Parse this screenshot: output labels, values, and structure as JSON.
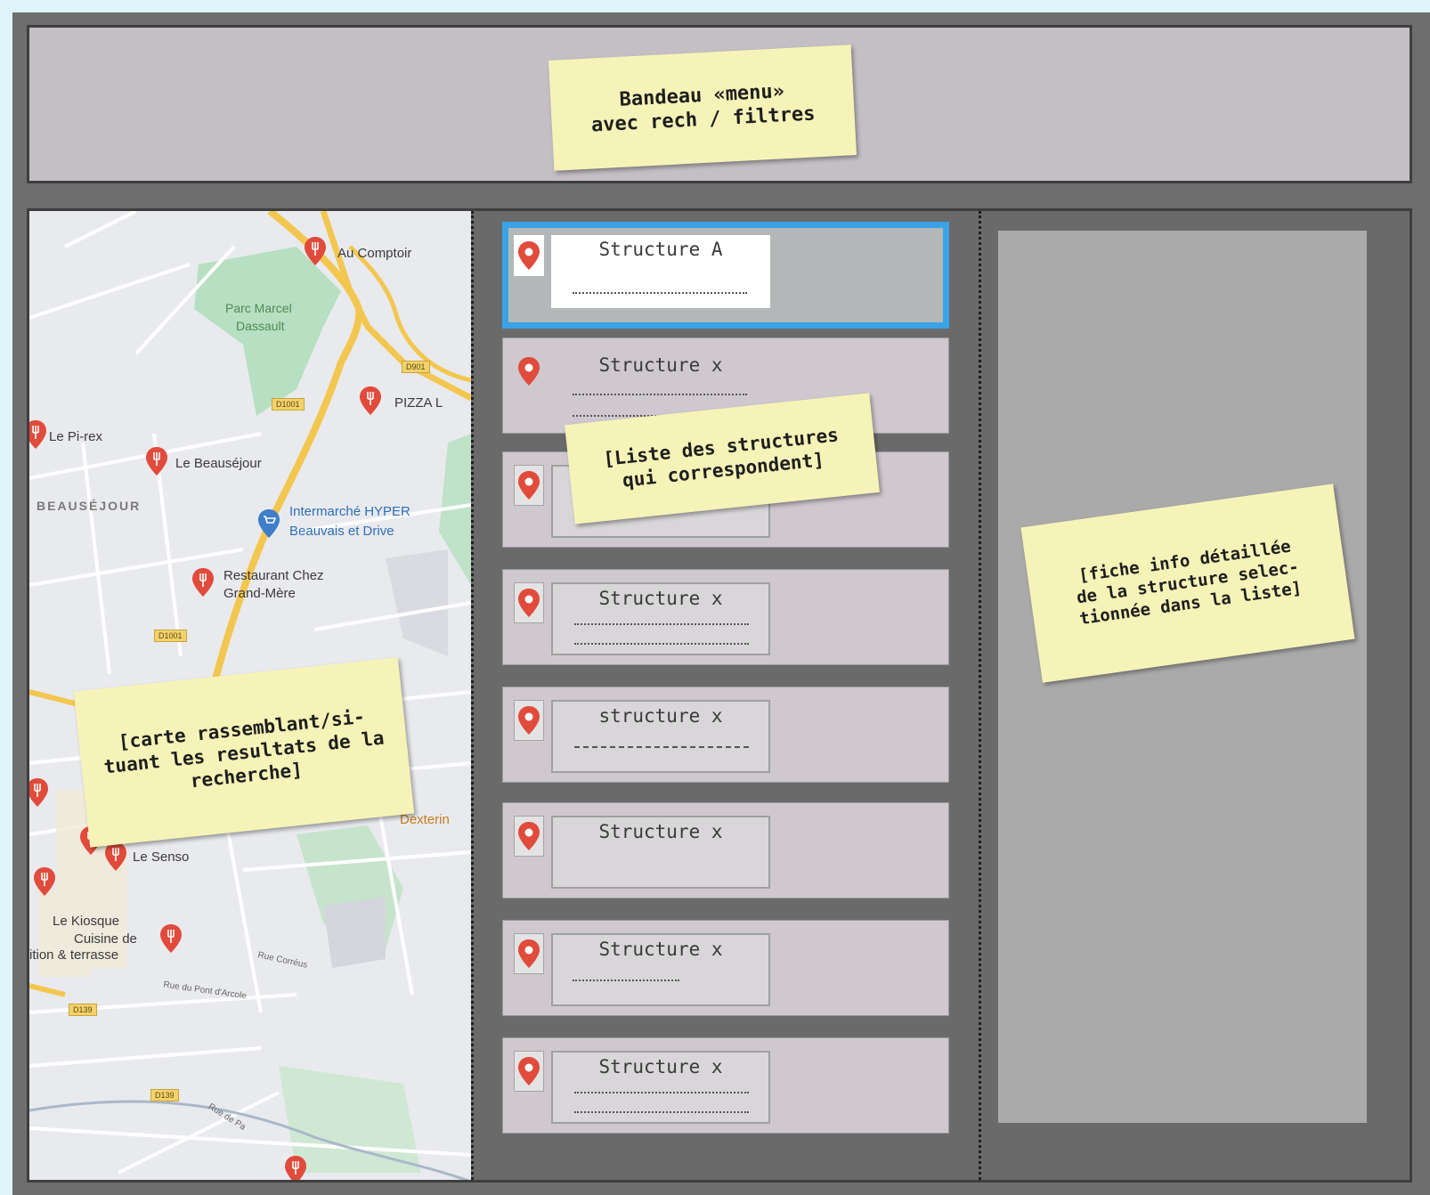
{
  "notes": {
    "header": [
      "Bandeau «menu»",
      "avec  rech / filtres"
    ],
    "list": [
      "[Liste des structures",
      "qui correspondent]"
    ],
    "map": [
      "[carte  rassemblant/si-",
      "tuant les resultats de la",
      "recherche]"
    ],
    "detail": [
      "[fiche info détaillée",
      "de la structure selec-",
      "tionnée dans la liste]"
    ]
  },
  "map": {
    "places": [
      "Au Comptoir",
      "PIZZA L",
      "Le Pi-rex",
      "Le Beauséjour",
      "Restaurant Chez",
      "Grand-Mère",
      "Le Senso",
      "Le Kiosque",
      "Cuisine de",
      "ition & terrasse",
      "Dexterin"
    ],
    "parks": [
      "Parc Marcel",
      "Dassault"
    ],
    "district": "BEAUSÉJOUR",
    "store": [
      "Intermarché HYPER",
      "Beauvais et Drive"
    ],
    "roads": [
      "D901",
      "D1001",
      "D1001",
      "D139",
      "D139"
    ],
    "streets": [
      "Rue du Pont d'Arcole",
      "Rue Corréus",
      "Rue de Pa"
    ]
  },
  "list": {
    "items": [
      {
        "title": "Structure A",
        "selected": true
      },
      {
        "title": "Structure x",
        "selected": false
      },
      {
        "title": "",
        "selected": false
      },
      {
        "title": "Structure x",
        "selected": false
      },
      {
        "title": "structure x",
        "selected": false
      },
      {
        "title": "Structure x",
        "selected": false
      },
      {
        "title": "Structure x",
        "selected": false
      },
      {
        "title": "Structure x",
        "selected": false
      }
    ]
  },
  "colors": {
    "frame": "#6e6e6e",
    "header": "#c4bfc4",
    "selected_border": "#3aa3e6",
    "note": "#f6f3b8",
    "pin": "#e04b3c",
    "detail_panel": "#aaaaaa"
  },
  "icons": {
    "list_marker": "map-pin-icon",
    "restaurant_marker": "restaurant-pin-icon",
    "store_marker": "shopping-cart-pin-icon"
  }
}
